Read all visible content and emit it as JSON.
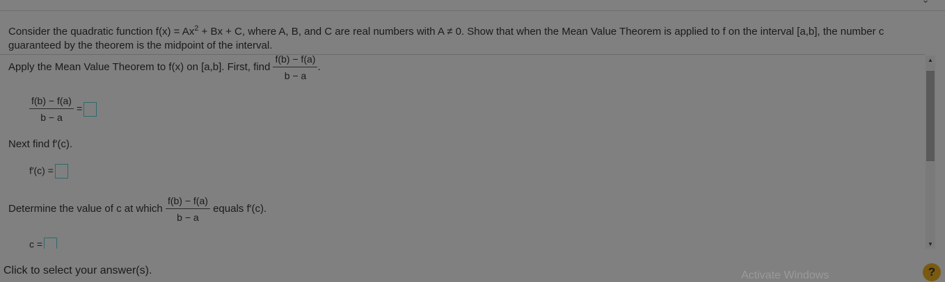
{
  "question": {
    "part1": "Consider the quadratic function f(x) = Ax",
    "exponent": "2",
    "part2": " + Bx + C, where A, B, and C are real numbers with A ≠ 0. Show that when the Mean Value Theorem is applied to f on the interval [a,b], the number c guaranteed by the theorem is the midpoint of the interval."
  },
  "steps": {
    "step1_text": "Apply the Mean Value Theorem to f(x) on [a,b]. First, find",
    "step1_period": ".",
    "frac_num": "f(b) − f(a)",
    "frac_den": "b − a",
    "eq": "=",
    "step2_text": "Next find f′(c).",
    "fprime_label": "f′(c) =",
    "step3_text": "Determine the value of c at which",
    "step3_tail": "equals f′(c).",
    "c_label": "c ="
  },
  "footer": {
    "hint": "Click to select your answer(s).",
    "watermark": "Activate Windows",
    "help": "?"
  },
  "icons": {
    "scroll_up": "triangle-up-icon",
    "scroll_down": "triangle-down-icon",
    "help": "help-icon",
    "chevron": "chevron-down-icon"
  }
}
